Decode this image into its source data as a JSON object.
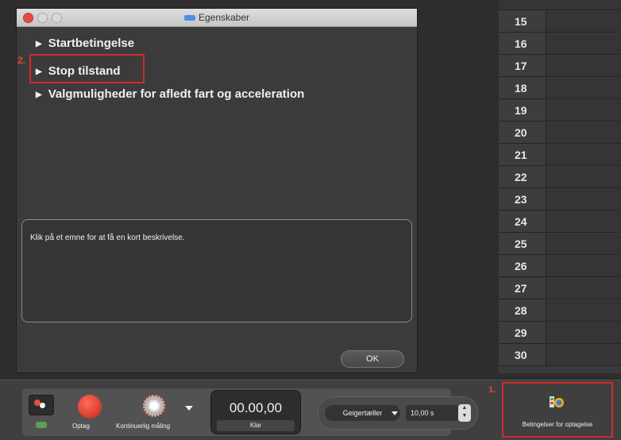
{
  "dialog": {
    "title": "Egenskaber",
    "items": [
      {
        "label": "Startbetingelse"
      },
      {
        "label": "Stop tilstand"
      },
      {
        "label": "Valgmuligheder for afledt fart og acceleration"
      }
    ],
    "description": "Klik på et emne for at få en kort beskrivelse.",
    "ok_label": "OK"
  },
  "annotations": {
    "step1": "1.",
    "step2": "2."
  },
  "table": {
    "rows": [
      "15",
      "16",
      "17",
      "18",
      "19",
      "20",
      "21",
      "22",
      "23",
      "24",
      "25",
      "26",
      "27",
      "28",
      "29",
      "30"
    ]
  },
  "toolbar": {
    "record_label": "Optag",
    "continuous_label": "Kontinuerlig måling",
    "timer_value": "00.00,00",
    "timer_status": "Klar",
    "sensor_label": "Geigertæller",
    "time_value": "10,00 s",
    "conditions_label": "Betingelser for optagelse"
  },
  "colors": {
    "accent_red": "#d22a2a",
    "record": "#e54d42"
  }
}
